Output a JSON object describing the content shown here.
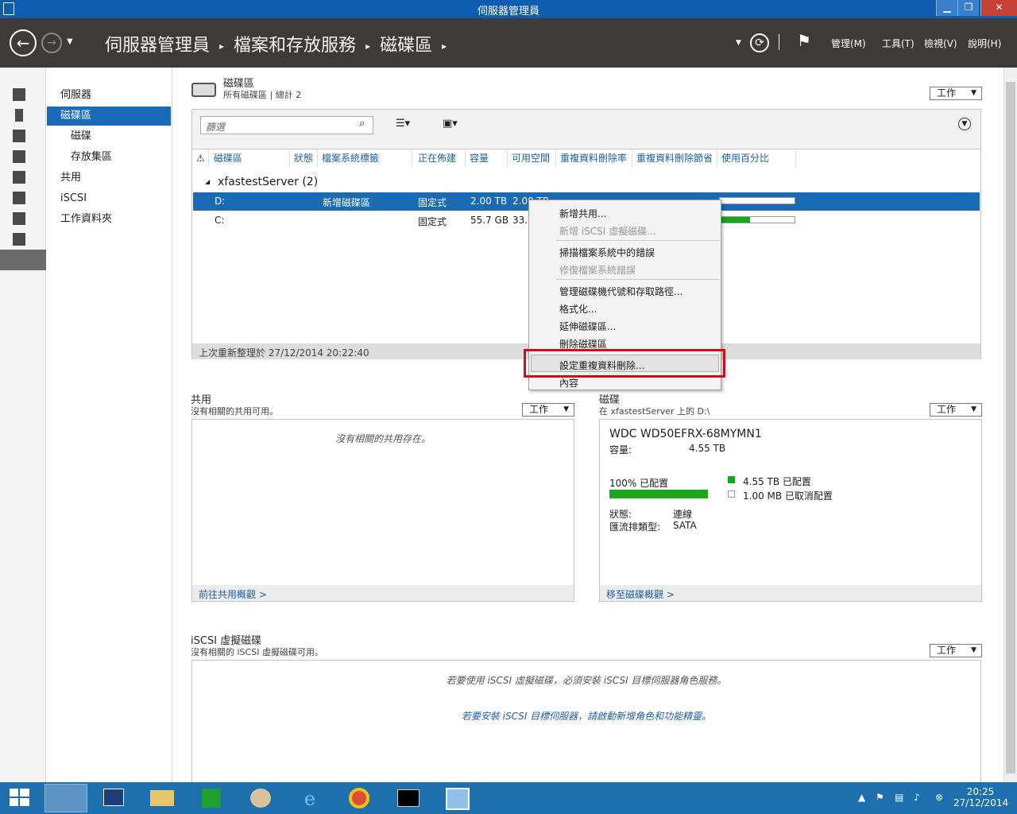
{
  "window": {
    "title": "伺服器管理員",
    "minimize": "▁",
    "maximize": "❐",
    "close": "✕"
  },
  "toolbar": {
    "breadcrumb": [
      "伺服器管理員",
      "檔案和存放服務",
      "磁碟區"
    ],
    "menus": [
      "管理(M)",
      "工具(T)",
      "檢視(V)",
      "說明(H)"
    ]
  },
  "nav": {
    "items": [
      {
        "label": "伺服器",
        "active": false,
        "sub": false
      },
      {
        "label": "磁碟區",
        "active": true,
        "sub": false
      },
      {
        "label": "磁碟",
        "active": false,
        "sub": true
      },
      {
        "label": "存放集區",
        "active": false,
        "sub": true
      },
      {
        "label": "共用",
        "active": false,
        "sub": false
      },
      {
        "label": "iSCSI",
        "active": false,
        "sub": false
      },
      {
        "label": "工作資料夾",
        "active": false,
        "sub": false
      }
    ]
  },
  "volumes": {
    "title": "磁碟區",
    "subtitle": "所有磁碟區 | 總計 2",
    "tasks": "工作",
    "filter_placeholder": "篩選",
    "columns": [
      "磁碟區",
      "狀態",
      "檔案系統標籤",
      "正在佈建",
      "容量",
      "可用空間",
      "重複資料刪除率",
      "重複資料刪除節省",
      "使用百分比"
    ],
    "group": "xfastestServer (2)",
    "rows": [
      {
        "volume": "D:",
        "label": "新增磁碟區",
        "provisioning": "固定式",
        "capacity": "2.00 TB",
        "free": "2.00 TB",
        "usage": 0.0,
        "selected": true
      },
      {
        "volume": "C:",
        "label": "",
        "provisioning": "固定式",
        "capacity": "55.7 GB",
        "free": "33.3",
        "usage": 0.4,
        "selected": false
      }
    ],
    "last_refresh": "上次重新整理於 27/12/2014 20:22:40"
  },
  "context_menu": {
    "items": [
      {
        "label": "新增共用...",
        "disabled": false
      },
      {
        "label": "新增 iSCSI 虛擬磁碟...",
        "disabled": true
      },
      {
        "label": "掃描檔案系統中的錯誤",
        "disabled": false
      },
      {
        "label": "修復檔案系統錯誤",
        "disabled": true
      },
      {
        "label": "管理磁碟機代號和存取路徑...",
        "disabled": false
      },
      {
        "label": "格式化...",
        "disabled": false
      },
      {
        "label": "延伸磁碟區...",
        "disabled": false
      },
      {
        "label": "刪除磁碟區",
        "disabled": false
      },
      {
        "label": "設定重複資料刪除...",
        "disabled": false
      },
      {
        "label": "內容",
        "disabled": false
      }
    ]
  },
  "shares": {
    "title": "共用",
    "subtitle": "沒有相關的共用可用。",
    "tasks": "工作",
    "empty": "沒有相關的共用存在。",
    "footer": "前往共用概觀 >"
  },
  "disk": {
    "title": "磁碟",
    "subtitle": "在 xfastestServer 上的 D:\\",
    "tasks": "工作",
    "model": "WDC WD50EFRX-68MYMN1",
    "capacity_label": "容量:",
    "capacity": "4.55 TB",
    "allocated_label": "100% 已配置",
    "allocated_fraction": 1.0,
    "legend_alloc": "4.55 TB 已配置",
    "legend_unalloc": "1.00 MB 已取消配置",
    "status_label": "狀態:",
    "status": "連線",
    "bus_label": "匯流排類型:",
    "bus": "SATA",
    "footer": "移至磁碟概觀 >"
  },
  "iscsi": {
    "title": "iSCSI 虛擬磁碟",
    "subtitle": "沒有相關的 iSCSI 虛擬磁碟可用。",
    "tasks": "工作",
    "msg1": "若要使用 iSCSI 虛擬磁碟，必須安裝 iSCSI 目標伺服器角色服務。",
    "msg2": "若要安裝 iSCSI 目標伺服器，請啟動新增角色和功能精靈。"
  },
  "taskbar": {
    "time": "20:25",
    "date": "27/12/2014"
  }
}
